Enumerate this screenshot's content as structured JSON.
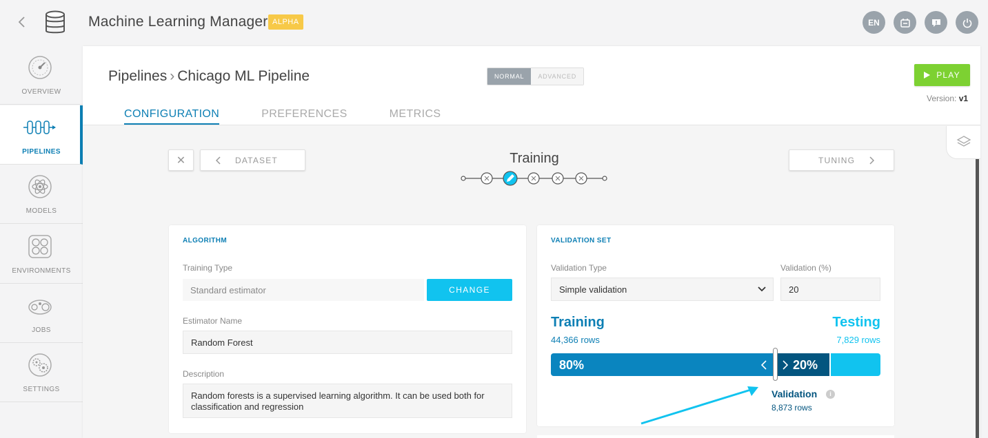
{
  "app": {
    "title": "Machine Learning Manager",
    "badge": "ALPHA",
    "back_icon": "chevron-left-icon",
    "logo_icon": "database-icon"
  },
  "header_actions": {
    "language": "EN",
    "icons": [
      "language-icon",
      "notebook-icon",
      "feedback-icon",
      "power-icon"
    ]
  },
  "sidebar": {
    "items": [
      {
        "label": "OVERVIEW",
        "icon": "gauge-icon",
        "active": false
      },
      {
        "label": "PIPELINES",
        "icon": "pipeline-icon",
        "active": true
      },
      {
        "label": "MODELS",
        "icon": "atom-icon",
        "active": false
      },
      {
        "label": "ENVIRONMENTS",
        "icon": "environment-icon",
        "active": false
      },
      {
        "label": "JOBS",
        "icon": "jobs-icon",
        "active": false
      },
      {
        "label": "SETTINGS",
        "icon": "settings-icon",
        "active": false
      }
    ]
  },
  "page": {
    "breadcrumb_root": "Pipelines",
    "breadcrumb_current": "Chicago ML Pipeline",
    "mode_normal": "NORMAL",
    "mode_advanced": "ADVANCED",
    "play_label": "PLAY",
    "version_label": "Version:",
    "version_value": "v1"
  },
  "tabs": [
    {
      "label": "CONFIGURATION",
      "active": true
    },
    {
      "label": "PREFERENCES",
      "active": false
    },
    {
      "label": "METRICS",
      "active": false
    }
  ],
  "wizard": {
    "prev_label": "DATASET",
    "next_label": "TUNING",
    "step_title": "Training",
    "step_count": 5,
    "current_step": 2
  },
  "algorithm": {
    "title": "ALGORITHM",
    "training_type_label": "Training Type",
    "training_type_value": "Standard estimator",
    "change_label": "CHANGE",
    "estimator_name_label": "Estimator Name",
    "estimator_name_value": "Random Forest",
    "description_label": "Description",
    "description_value": "Random forests is a supervised learning algorithm. It can be used both for classification and regression"
  },
  "validation": {
    "title": "VALIDATION SET",
    "type_label": "Validation Type",
    "type_value": "Simple validation",
    "pct_label": "Validation (%)",
    "pct_value": "20",
    "training_label": "Training",
    "training_rows": "44,366 rows",
    "testing_label": "Testing",
    "testing_rows": "7,829 rows",
    "training_pct": "80%",
    "validation_pct": "20%",
    "validation_label": "Validation",
    "validation_rows": "8,873 rows"
  },
  "colors": {
    "accent": "#0d7fb4",
    "cyan": "#11c3ef",
    "dark_blue": "#03557f",
    "play_green": "#7dd132",
    "alpha_yellow": "#f7c948"
  }
}
